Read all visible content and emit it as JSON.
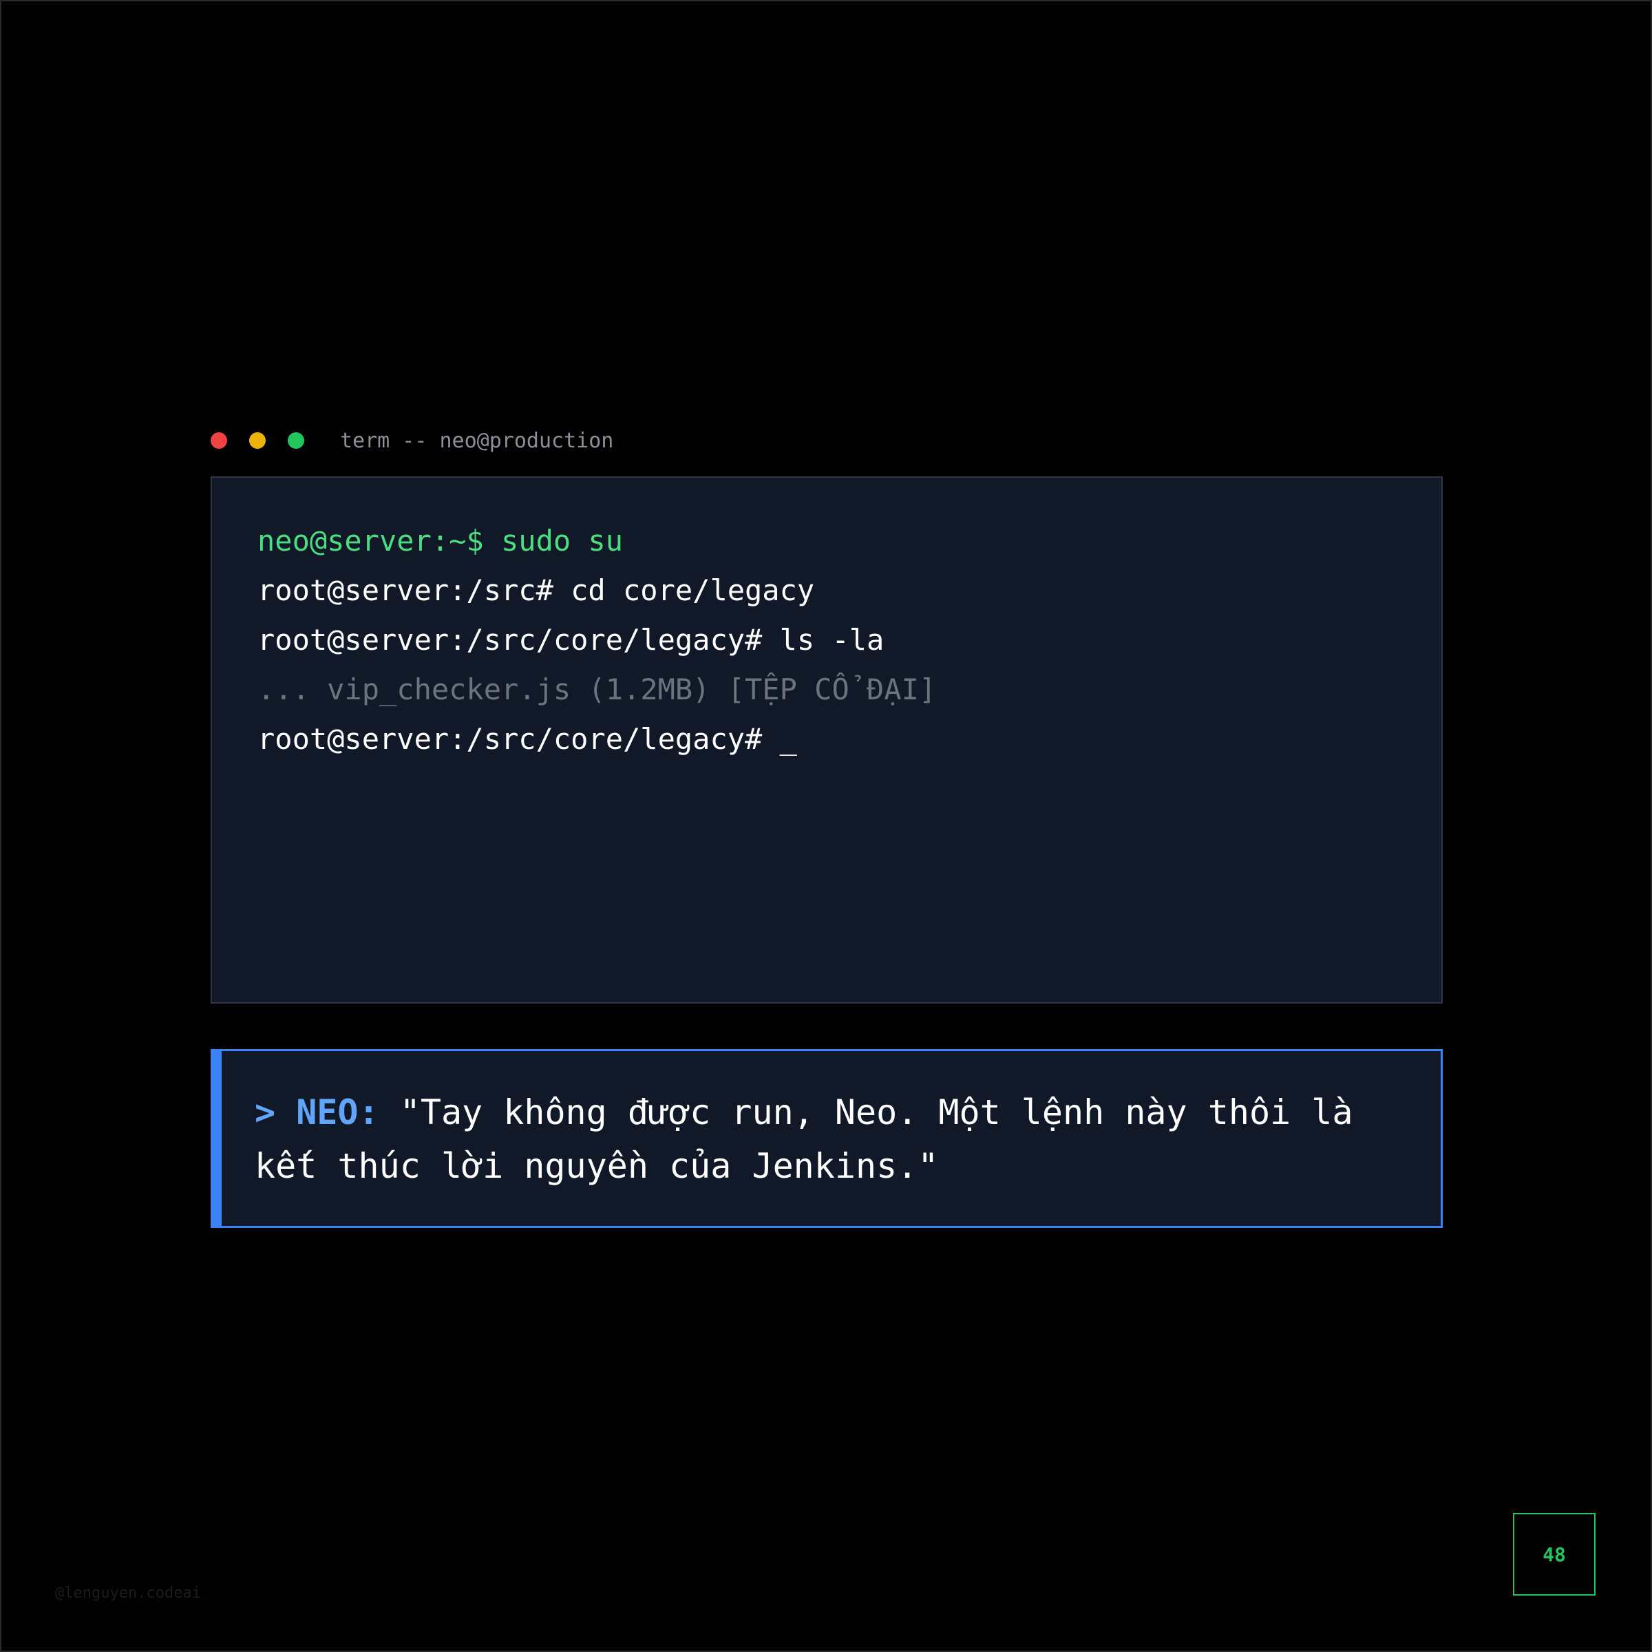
{
  "window": {
    "controls": [
      {
        "name": "close",
        "color": "#ef4444"
      },
      {
        "name": "minimize",
        "color": "#eab308"
      },
      {
        "name": "maximize",
        "color": "#22c55e"
      }
    ],
    "title": "term -- neo@production"
  },
  "terminal": {
    "lines": [
      {
        "text": "neo@server:~$ sudo su",
        "style": "green"
      },
      {
        "text": "root@server:/src# cd core/legacy",
        "style": "white"
      },
      {
        "text": "root@server:/src/core/legacy# ls -la",
        "style": "white"
      },
      {
        "text": "... vip_checker.js (1.2MB) [TỆP CỔ ĐẠI]",
        "style": "dim"
      },
      {
        "text": "root@server:/src/core/legacy# _",
        "style": "white"
      }
    ]
  },
  "dialog": {
    "speaker": "> NEO:",
    "quote": "\"Tay không được run, Neo. Một lệnh này thôi là kết thúc lời nguyền của Jenkins.\""
  },
  "footer": {
    "watermark": "@lenguyen.codeai",
    "page_number": "48"
  },
  "colors": {
    "background": "#000000",
    "terminal_bg": "#111827",
    "prompt_green": "#4ade80",
    "accent_blue": "#3b82f6",
    "speaker_blue": "#60a5fa",
    "dim_text": "#6b7280",
    "page_green": "#22c55e"
  }
}
